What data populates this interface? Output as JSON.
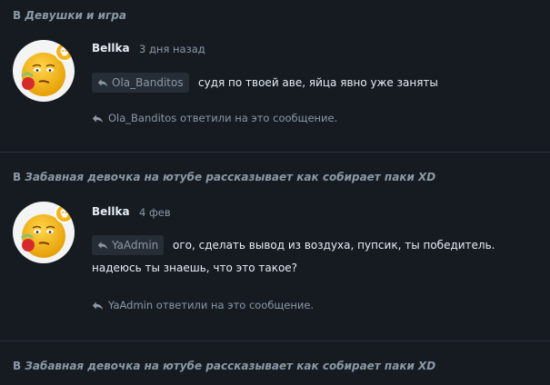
{
  "posts": [
    {
      "topic_prefix": "В ",
      "topic": "Девушки и игра",
      "author": "Bellka",
      "time": "3 дня назад",
      "mention": "Ola_Banditos",
      "text_line1": "судя по твоей аве, яйца явно уже заняты",
      "text_line2": "",
      "reply_note": "Ola_Banditos ответили на это сообщение."
    },
    {
      "topic_prefix": "В ",
      "topic": "Забавная девочка на ютубе рассказывает как собирает паки XD",
      "author": "Bellka",
      "time": "4 фев",
      "mention": "YaAdmin",
      "text_line1": "ого, сделать вывод из воздуха, пупсик, ты победитель.",
      "text_line2": "надеюсь ты знаешь, что это такое?",
      "reply_note": "YaAdmin ответили на это сообщение."
    },
    {
      "topic_prefix": "В ",
      "topic": "Забавная девочка на ютубе рассказывает как собирает паки XD"
    }
  ],
  "icons": {
    "reply": "reply-icon",
    "avatar_emoji": "sick-face-emoji",
    "avatar_badge": "skull-badge"
  },
  "colors": {
    "background": "#161b22",
    "muted": "#8b98a5",
    "text": "#e6edf3",
    "chip": "#262d36"
  }
}
